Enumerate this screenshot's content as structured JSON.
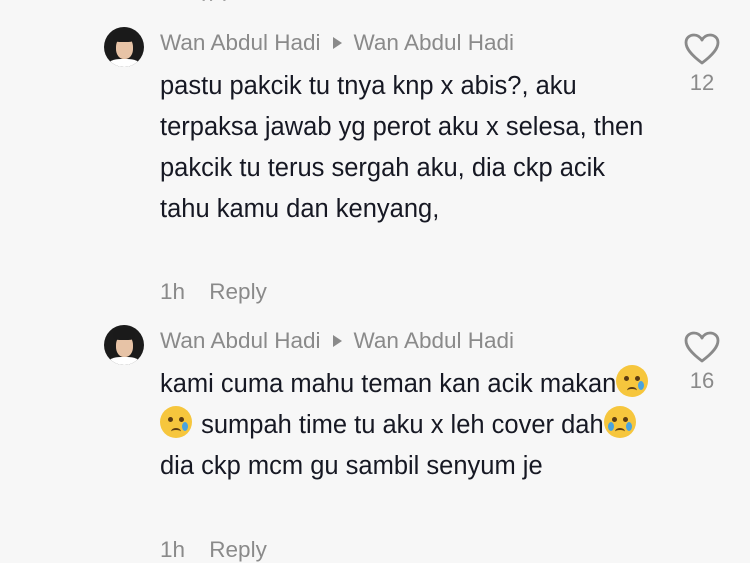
{
  "comments": [
    {
      "author": "Wan Abdul Hadi",
      "reply_to": "Wan Abdul Hadi",
      "text": "pastu pakcik tu tnya knp x abis?, aku terpaksa jawab yg perot aku x selesa, then pakcik tu terus sergah aku, dia ckp acik tahu kamu dan kenyang,",
      "time": "1h",
      "reply_label": "Reply",
      "likes": "12"
    },
    {
      "author": "Wan Abdul Hadi",
      "reply_to": "Wan Abdul Hadi",
      "text_parts": [
        "kami cuma mahu teman kan acik makan",
        " sumpah time tu aku x leh cover dah",
        " dia ckp mcm gu sambil senyum je"
      ],
      "emojis": [
        "crying-face",
        "crying-face",
        "loudly-crying-face"
      ],
      "time": "1h",
      "reply_label": "Reply",
      "likes": "16"
    }
  ],
  "icons": {
    "like": "heart-outline-icon",
    "reply_arrow": "triangle-right-icon"
  },
  "colors": {
    "text_primary": "#161823",
    "text_secondary": "#8a8a8a",
    "background": "#f7f7f7"
  }
}
